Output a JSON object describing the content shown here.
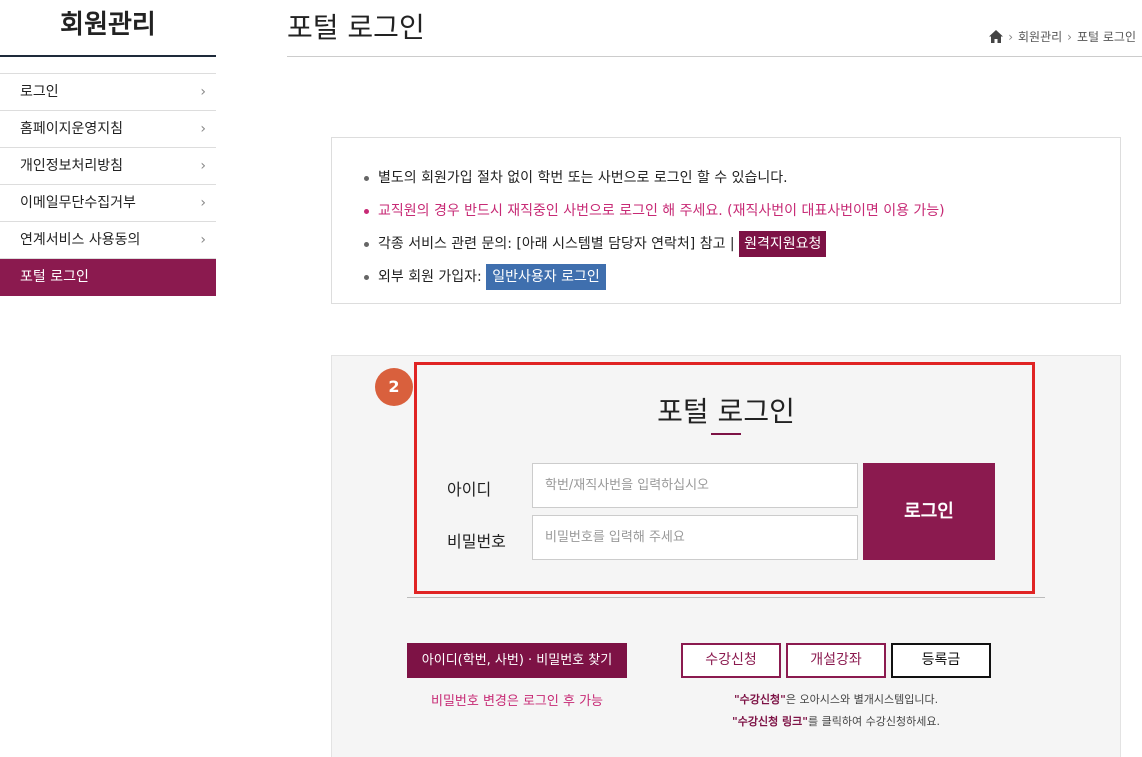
{
  "sidebar": {
    "title": "회원관리",
    "items": [
      {
        "label": "로그인",
        "chevron": "›"
      },
      {
        "label": "홈페이지운영지침",
        "chevron": "›"
      },
      {
        "label": "개인정보처리방침",
        "chevron": "›"
      },
      {
        "label": "이메일무단수집거부",
        "chevron": "›"
      },
      {
        "label": "연계서비스 사용동의",
        "chevron": "›"
      },
      {
        "label": "포털 로그인"
      }
    ]
  },
  "header": {
    "title": "포털 로그인",
    "breadcrumb": [
      "회원관리",
      "포털 로그인"
    ]
  },
  "notice": {
    "line1": "별도의 회원가입 절차 없이 학번 또는 사번으로 로그인 할 수 있습니다.",
    "line2": "교직원의 경우 반드시 재직중인 사번으로 로그인 해 주세요. (재직사번이 대표사번이면 이용 가능)",
    "line3": "각종 서비스 관련 문의: [아래 시스템별 담당자 연락처] 참고 |",
    "line3_button": "원격지원요청",
    "line4": "외부 회원 가입자:",
    "line4_button": "일반사용자 로그인"
  },
  "login": {
    "badge": "2",
    "title": "포털 로그인",
    "id_label": "아이디",
    "id_placeholder": "학번/재직사번을 입력하십시오",
    "pw_label": "비밀번호",
    "pw_placeholder": "비밀번호를 입력해 주세요",
    "submit_label": "로그인"
  },
  "bottom": {
    "find_button": "아이디(학번, 사번) · 비밀번호 찾기",
    "pw_note": "비밀번호 변경은 로그인 후 가능",
    "course_button": "수강신청",
    "open_course_button": "개설강좌",
    "fee_button": "등록금",
    "info1_bold": "\"수강신청\"",
    "info1_rest": "은 오아시스와 별개시스템입니다.",
    "info2_bold": "\"수강신청 링크\"",
    "info2_rest": "를 클릭하여 수강신청하세요."
  },
  "colors": {
    "accent": "#8b1a4f",
    "accent_dark": "#7d1245",
    "highlight": "#e02424",
    "badge": "#d9603d",
    "blue_tag": "#3f6fae",
    "pink_text": "#c72a75"
  }
}
